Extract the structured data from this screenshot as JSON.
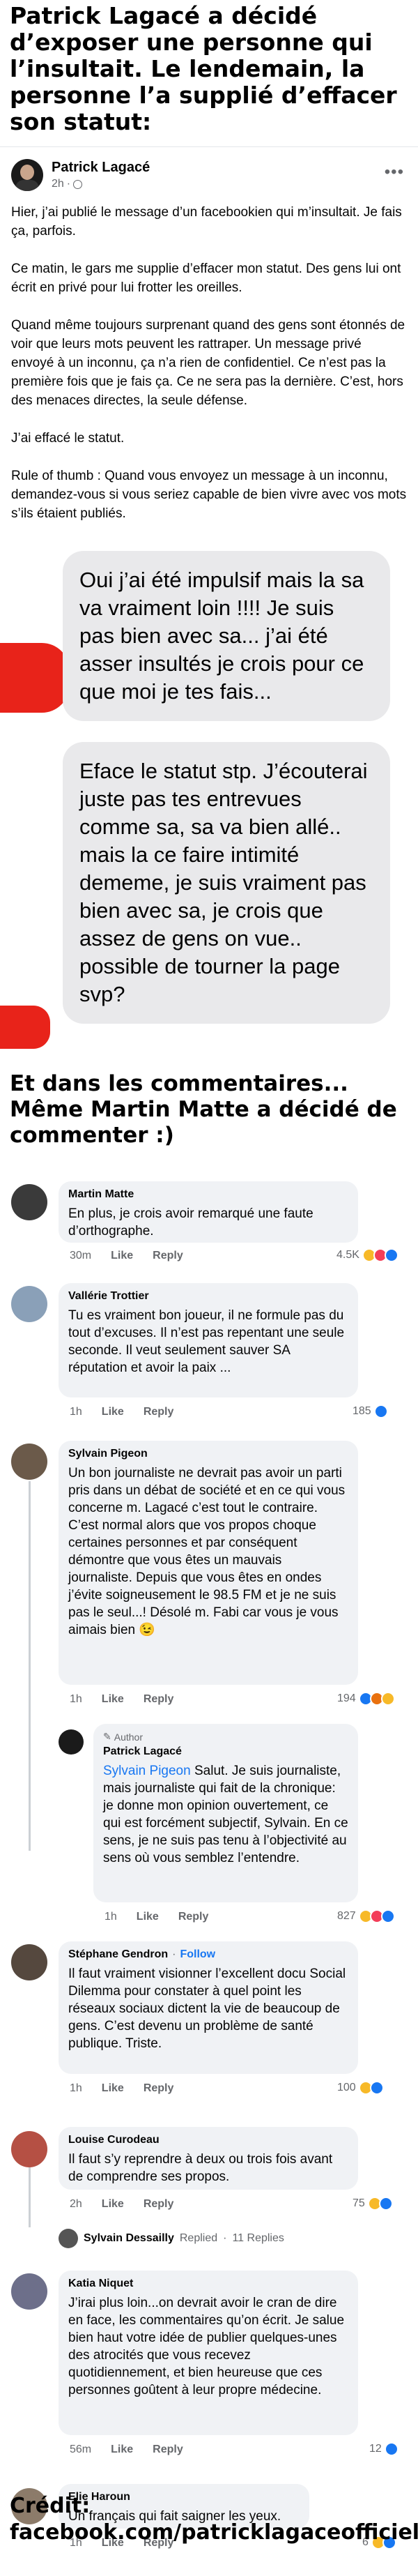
{
  "top_heading": "Patrick Lagacé a décidé d’exposer une personne qui l’insultait. Le lendemain, la personne l’a supplié d’effacer son statut:",
  "post": {
    "author": "Patrick Lagacé",
    "time": "2h",
    "more_glyph": "•••",
    "paragraphs": [
      "Hier, j’ai publié le message d’un facebookien qui m’insultait. Je fais ça, parfois.",
      "Ce matin, le gars me supplie d’effacer mon statut. Des gens lui ont écrit en privé pour lui frotter les oreilles.",
      "Quand même toujours surprenant quand des gens sont étonnés de voir que leurs mots peuvent les rattraper. Un message privé envoyé à un inconnu, ça n’a rien de confidentiel. Ce n’est pas la première fois que je fais ça. Ce ne sera pas la dernière. C’est, hors des menaces directes, la seule défense.",
      "J’ai effacé le statut.",
      "Rule of thumb : Quand vous envoyez un message à un inconnu, demandez-vous si vous seriez capable de bien vivre avec vos mots s’ils étaient publiés."
    ]
  },
  "messages": [
    "Oui j’ai été impulsif mais la sa va vraiment loin !!!! Je suis pas bien avec sa... j’ai été asser insultés je crois pour ce que moi je tes fais...",
    "Eface le statut stp. J’écouterai juste pas tes entrevues comme sa, sa va bien allé.. mais la ce faire intimité dememe, je suis vraiment pas bien avec sa, je crois que assez de gens on vue.. possible de tourner la page svp?"
  ],
  "mid_heading": "Et dans les commentaires... Même Martin Matte a décidé de commenter :)",
  "comments": {
    "martin": {
      "name": "Martin Matte",
      "text": "En plus, je crois avoir remarqué une faute d’orthographe.",
      "time": "30m",
      "like": "Like",
      "reply": "Reply",
      "count": "4.5K"
    },
    "vallerie": {
      "name": "Vallérie Trottier",
      "text": "Tu es vraiment bon joueur, il ne formule pas du tout d’excuses. Il n’est pas repentant une seule seconde. Il veut seulement sauver SA réputation et avoir la paix ...",
      "time": "1h",
      "like": "Like",
      "reply": "Reply",
      "count": "185"
    },
    "sylvain": {
      "name": "Sylvain Pigeon",
      "text": "Un bon journaliste ne devrait pas avoir un parti pris dans un débat de société et en ce qui vous concerne m. Lagacé c’est tout le contraire. C’est normal alors que vos propos choque certaines personnes et par conséquent démontre que vous êtes un mauvais journaliste. Depuis que vous êtes en ondes j’évite soigneusement le 98.5 FM et je ne suis pas le seul...! Désolé m. Fabi car vous je vous aimais bien",
      "emoji": "😉",
      "time": "1h",
      "like": "Like",
      "reply": "Reply",
      "count": "194"
    },
    "patrick_reply": {
      "badge": "Author",
      "name": "Patrick Lagacé",
      "mention": "Sylvain Pigeon",
      "text": " Salut. Je suis journaliste, mais journaliste qui fait de la chronique: je donne mon opinion ouvertement, ce qui est forcément subjectif, Sylvain. En ce sens, je ne suis pas tenu à l’objectivité au sens où vous semblez l’entendre.",
      "time": "1h",
      "like": "Like",
      "reply": "Reply",
      "count": "827"
    },
    "stephane": {
      "name": "Stéphane Gendron",
      "dot": " · ",
      "follow": "Follow",
      "text": "Il faut vraiment visionner l’excellent docu Social Dilemma pour constater à quel point les réseaux sociaux dictent la vie de beaucoup de gens. C’est devenu un problème de santé publique. Triste.",
      "time": "1h",
      "like": "Like",
      "reply": "Reply",
      "count": "100"
    },
    "louise": {
      "name": "Louise Curodeau",
      "text": "Il faut s’y reprendre à deux ou trois fois avant de comprendre ses propos.",
      "time": "2h",
      "like": "Like",
      "reply": "Reply",
      "count": "75"
    },
    "replied": {
      "name": "Sylvain Dessailly",
      "label": "Replied",
      "sep": " · ",
      "count": "11 Replies"
    },
    "katia": {
      "name": "Katia Niquet",
      "text": "J’irai plus loin...on devrait avoir le cran de dire en face, les commentaires qu’on écrit. Je salue bien haut votre idée de publier quelques-unes des atrocités que vous recevez quotidiennement, et bien heureuse que ces personnes goûtent à leur propre médecine.",
      "time": "56m",
      "like": "Like",
      "reply": "Reply",
      "count": "12"
    },
    "elie": {
      "name": "Elie Haroun",
      "text": "Un français qui fait saigner les yeux.",
      "time": "1h",
      "like": "Like",
      "reply": "Reply",
      "count": "6"
    }
  },
  "credit": "Crédit: facebook.com/patricklagaceofficiel",
  "colors": {
    "link": "#1877f2",
    "bubble": "#e9e9eb",
    "comment_bubble": "#f0f2f5",
    "meta": "#65676b",
    "red_mark": "#e8231a"
  }
}
